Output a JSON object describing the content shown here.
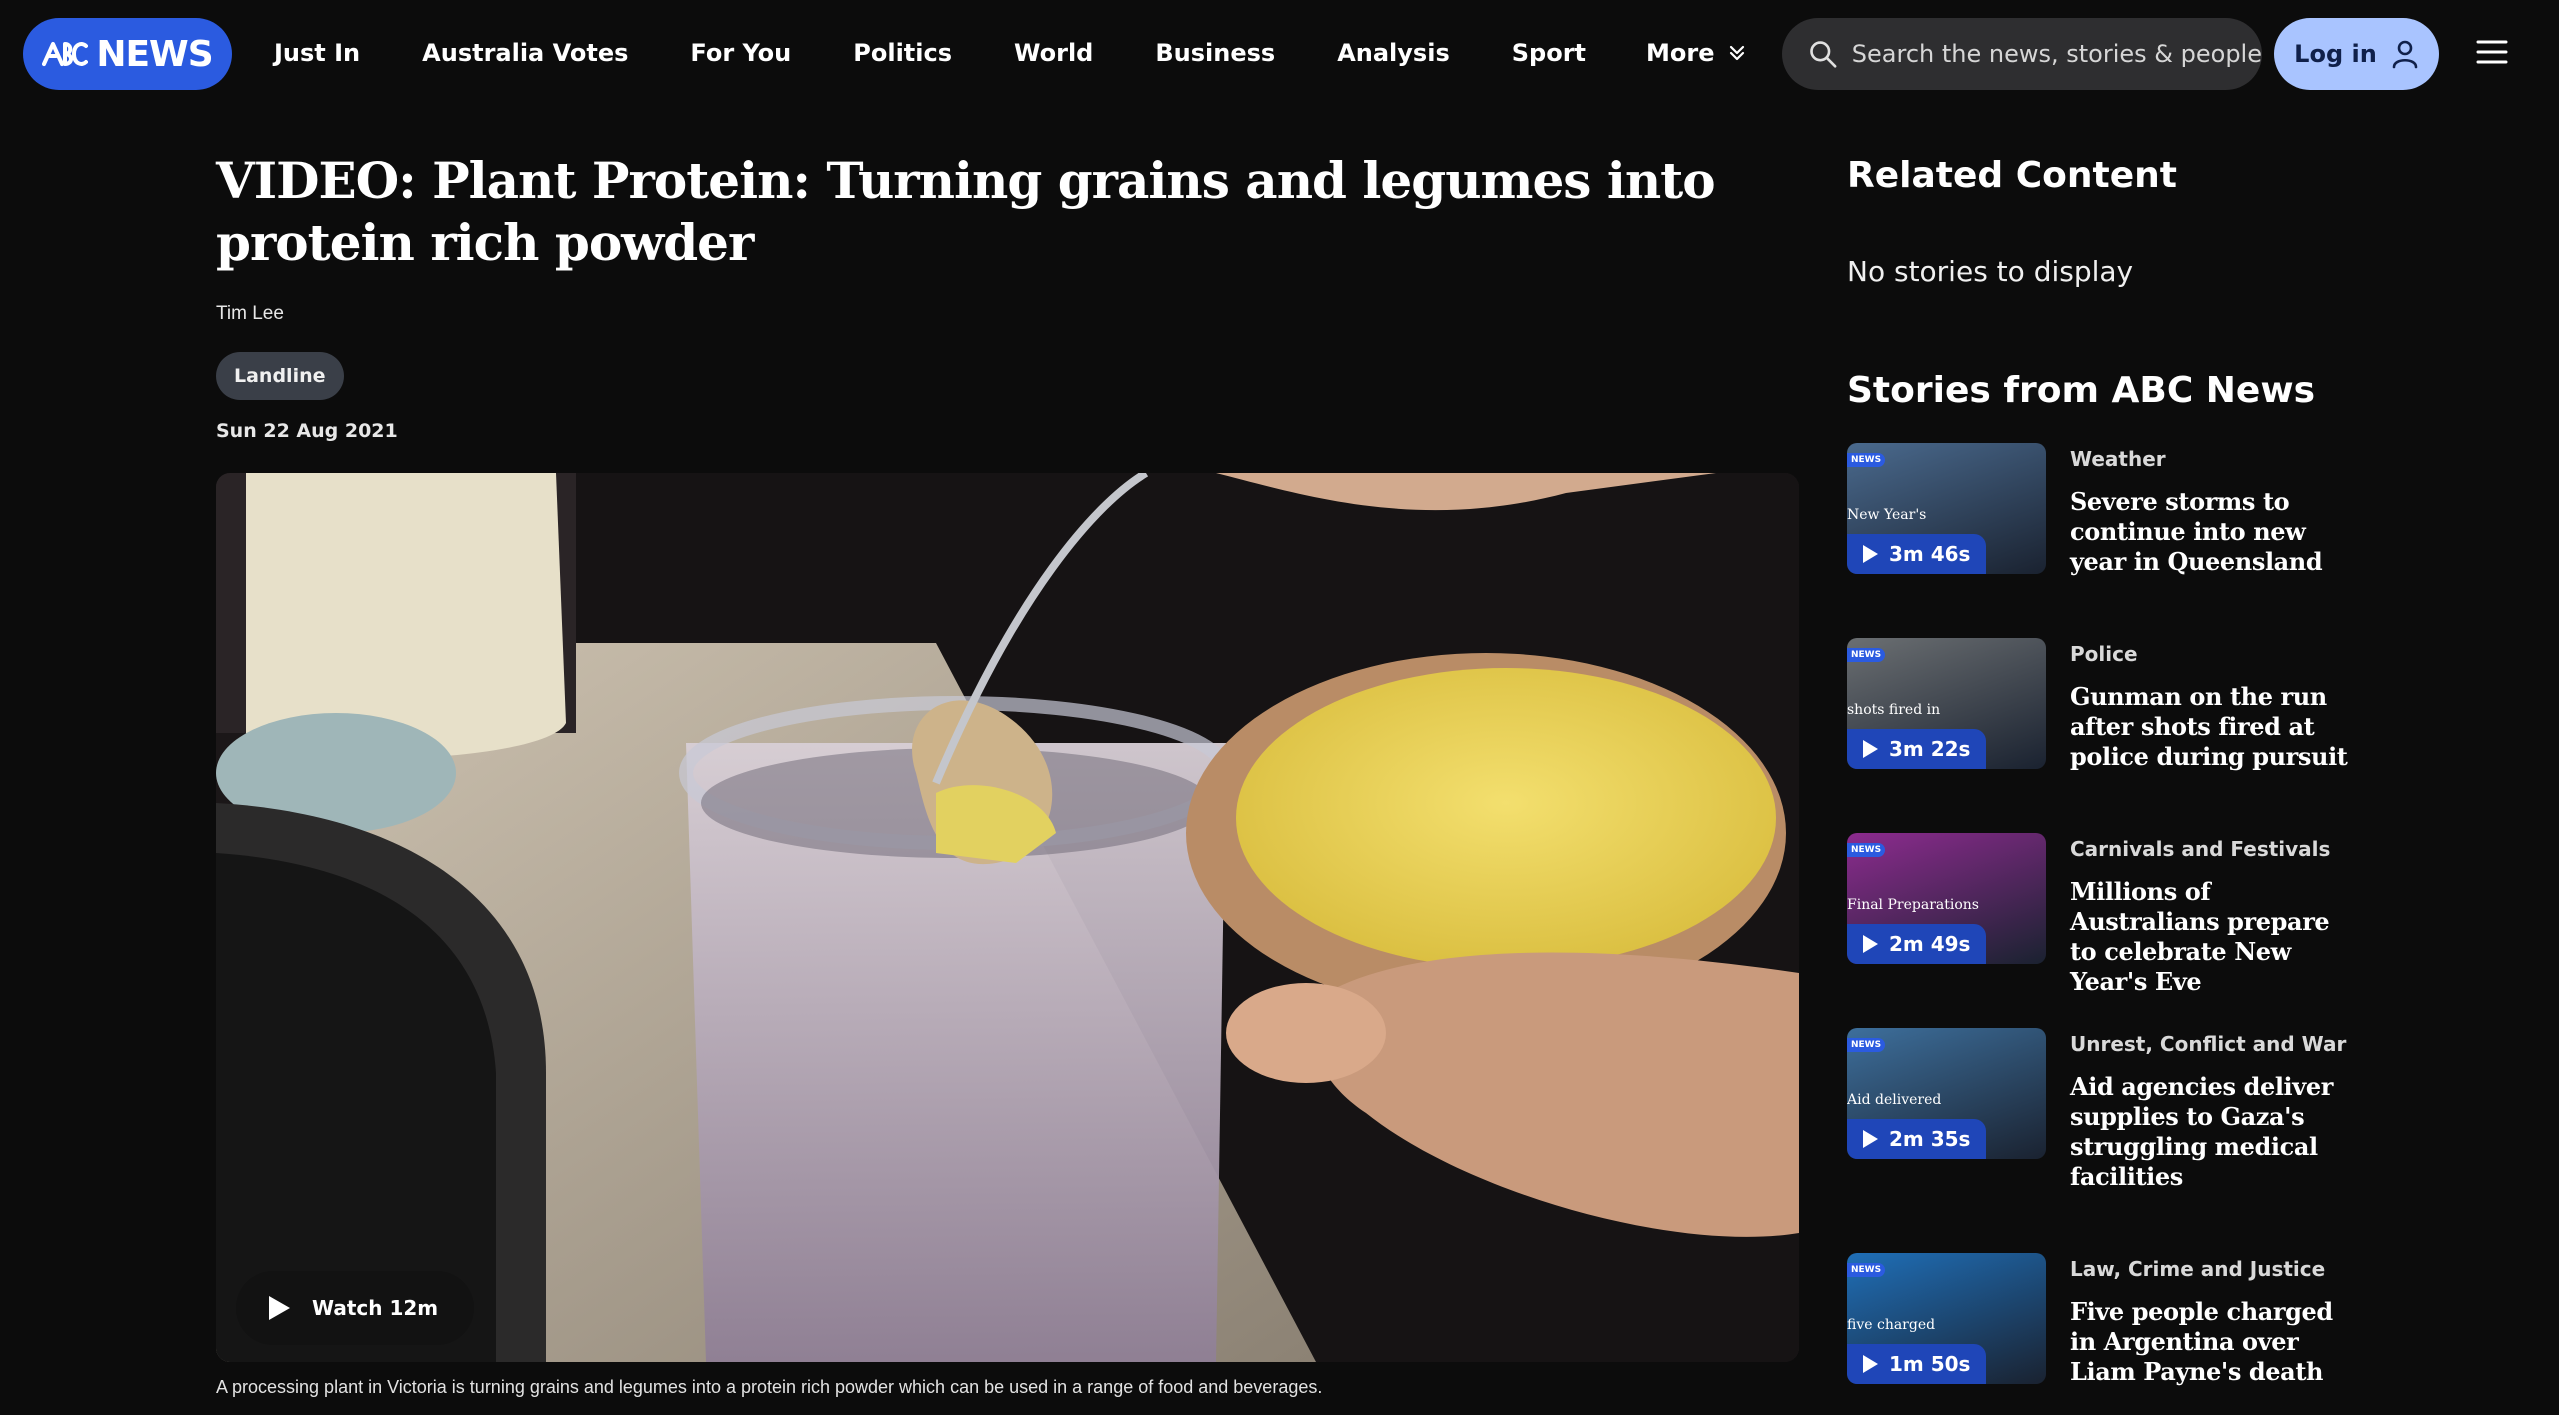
{
  "header": {
    "logo_text": "NEWS",
    "nav": [
      "Just In",
      "Australia Votes",
      "For You",
      "Politics",
      "World",
      "Business",
      "Analysis",
      "Sport"
    ],
    "more_label": "More",
    "search_placeholder": "Search the news, stories & people",
    "login_label": "Log in"
  },
  "article": {
    "headline": "VIDEO: Plant Protein: Turning grains and legumes into protein rich powder",
    "author": "Tim Lee",
    "tag": "Landline",
    "date": "Sun 22 Aug 2021",
    "watch_label": "Watch 12m",
    "caption": "A processing plant in Victoria is turning grains and legumes into a protein rich powder which can be used in a range of food and beverages."
  },
  "sidebar": {
    "related_heading": "Related Content",
    "no_stories": "No stories to display",
    "stories_heading": "Stories from ABC News",
    "stories": [
      {
        "category": "Weather",
        "title": "Severe storms to continue into new year in Queensland",
        "duration": "3m 46s",
        "thumb_text": "New Year's",
        "thumb_color": "#4a6a8e"
      },
      {
        "category": "Police",
        "title": "Gunman on the run after shots fired at police during pursuit",
        "duration": "3m 22s",
        "thumb_text": "shots fired in",
        "thumb_color": "#6b6f72"
      },
      {
        "category": "Carnivals and Festivals",
        "title": "Millions of Australians prepare to celebrate New Year's Eve",
        "duration": "2m 49s",
        "thumb_text": "Final Preparations",
        "thumb_color": "#8d2b8f"
      },
      {
        "category": "Unrest, Conflict and War",
        "title": "Aid agencies deliver supplies to Gaza's struggling medical facilities",
        "duration": "2m 35s",
        "thumb_text": "Aid delivered",
        "thumb_color": "#3d6f9c"
      },
      {
        "category": "Law, Crime and Justice",
        "title": "Five people charged in Argentina over Liam Payne's death",
        "duration": "1m 50s",
        "thumb_text": "five charged",
        "thumb_color": "#1f6fb8"
      }
    ],
    "thumb_badge": "NEWS"
  },
  "colors": {
    "brand": "#2b5be0",
    "login_bg": "#a9c4ff",
    "background": "#0c0c0c",
    "duration_bg": "#1f46b8"
  }
}
